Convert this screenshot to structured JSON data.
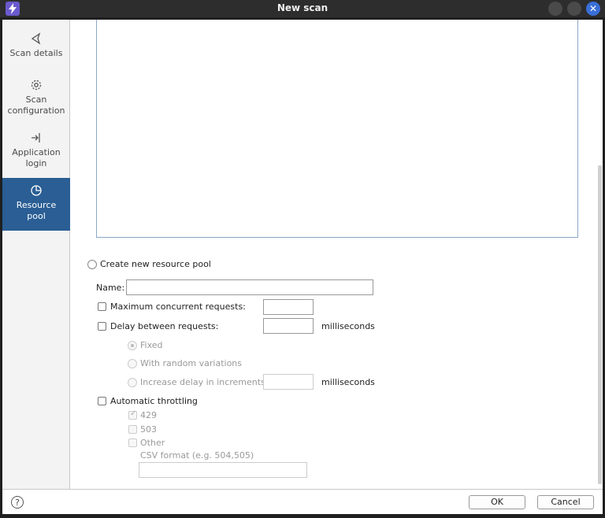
{
  "window": {
    "title": "New scan",
    "close_glyph": "✕"
  },
  "sidebar": {
    "items": [
      {
        "line1": "Scan details",
        "line2": "",
        "icon": "send-icon"
      },
      {
        "line1": "Scan",
        "line2": "configuration",
        "icon": "gear-icon"
      },
      {
        "line1": "Application",
        "line2": "login",
        "icon": "login-icon"
      },
      {
        "line1": "Resource",
        "line2": "pool",
        "icon": "pie-chart-icon",
        "active": true
      }
    ]
  },
  "form": {
    "create_pool_label": "Create new resource pool",
    "name_label": "Name:",
    "name_value": "",
    "max_concurrent_label": "Maximum concurrent requests:",
    "max_concurrent_value": "",
    "delay_label": "Delay between requests:",
    "delay_value": "",
    "milliseconds": "milliseconds",
    "fixed_label": "Fixed",
    "random_label": "With random variations",
    "increase_label": "Increase delay in increments of",
    "increase_value": "",
    "auto_throttle_label": "Automatic throttling",
    "code_429": "429",
    "code_503": "503",
    "other_label": "Other",
    "csv_label": "CSV format (e.g. 504,505)",
    "csv_value": ""
  },
  "footer": {
    "help_glyph": "?",
    "ok_label": "OK",
    "cancel_label": "Cancel"
  },
  "colors": {
    "accent": "#2a5e94",
    "close": "#3a6fd8"
  }
}
